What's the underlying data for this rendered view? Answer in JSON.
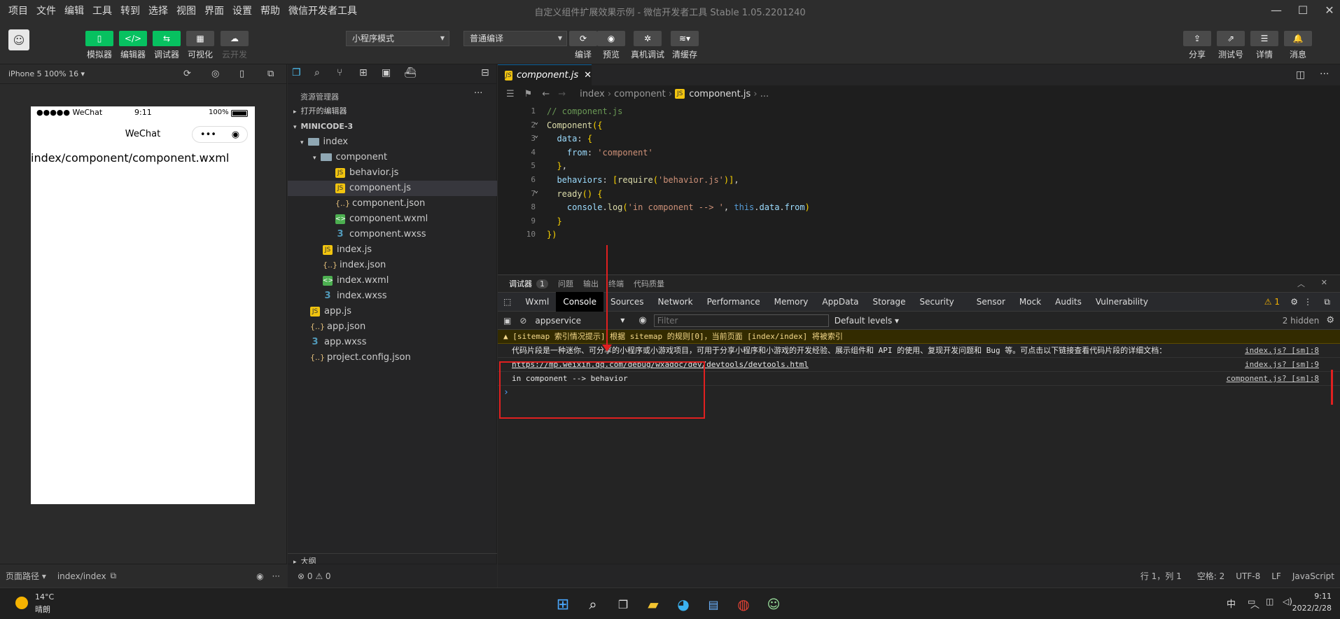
{
  "menu": [
    "项目",
    "文件",
    "编辑",
    "工具",
    "转到",
    "选择",
    "视图",
    "界面",
    "设置",
    "帮助",
    "微信开发者工具"
  ],
  "window_title": "自定义组件扩展效果示例 - 微信开发者工具 Stable 1.05.2201240",
  "toolbar": {
    "left": [
      {
        "label": "模拟器",
        "glyph": "▯",
        "style": "green"
      },
      {
        "label": "编辑器",
        "glyph": "</>",
        "style": "green"
      },
      {
        "label": "调试器",
        "glyph": "⇆",
        "style": "green"
      },
      {
        "label": "可视化",
        "glyph": "▦",
        "style": "gray"
      },
      {
        "label": "云开发",
        "glyph": "☁",
        "style": "gray"
      }
    ],
    "mode_select": "小程序模式",
    "compile_select": "普通编译",
    "mid": [
      {
        "label": "编译",
        "glyph": "⟳"
      },
      {
        "label": "预览",
        "glyph": "◉"
      },
      {
        "label": "真机调试",
        "glyph": "✲"
      },
      {
        "label": "清缓存",
        "glyph": "≋▾"
      }
    ],
    "right": [
      {
        "label": "分享",
        "glyph": "⇪"
      },
      {
        "label": "测试号",
        "glyph": "⇗"
      },
      {
        "label": "详情",
        "glyph": "☰"
      },
      {
        "label": "消息",
        "glyph": "🔔"
      }
    ]
  },
  "simulator": {
    "device": "iPhone 5 100% 16 ▾",
    "status_left": "●●●●● WeChat",
    "time": "9:11",
    "battery": "100%",
    "nav_title": "WeChat",
    "content": "index/component/component.wxml",
    "path_label": "页面路径 ▾",
    "path_value": "index/index"
  },
  "explorer": {
    "title": "资源管理器",
    "open_editors": "打开的编辑器",
    "project": "MINICODE-3",
    "outline": "大纲",
    "tree": [
      {
        "name": "index",
        "type": "folder",
        "depth": 1,
        "arrow": "▾"
      },
      {
        "name": "component",
        "type": "folder",
        "depth": 2,
        "arrow": "▾"
      },
      {
        "name": "behavior.js",
        "type": "js",
        "depth": 3
      },
      {
        "name": "component.js",
        "type": "js",
        "depth": 3,
        "active": true
      },
      {
        "name": "component.json",
        "type": "json",
        "depth": 3
      },
      {
        "name": "component.wxml",
        "type": "wxml",
        "depth": 3
      },
      {
        "name": "component.wxss",
        "type": "wxss",
        "depth": 3
      },
      {
        "name": "index.js",
        "type": "js",
        "depth": 2
      },
      {
        "name": "index.json",
        "type": "json",
        "depth": 2
      },
      {
        "name": "index.wxml",
        "type": "wxml",
        "depth": 2
      },
      {
        "name": "index.wxss",
        "type": "wxss",
        "depth": 2
      },
      {
        "name": "app.js",
        "type": "js",
        "depth": 1
      },
      {
        "name": "app.json",
        "type": "json",
        "depth": 1
      },
      {
        "name": "app.wxss",
        "type": "wxss",
        "depth": 1
      },
      {
        "name": "project.config.json",
        "type": "json",
        "depth": 1
      }
    ],
    "errors": "⊗ 0 ⚠ 0"
  },
  "editor": {
    "tab": "component.js",
    "breadcrumb": [
      "index",
      "component",
      "component.js",
      "..."
    ],
    "lines": [
      "// component.js",
      "Component({",
      "  data: {",
      "    from: 'component'",
      "  },",
      "  behaviors: [require('behavior.js')],",
      "  ready() {",
      "    console.log('in component --> ', this.data.from)",
      "  }",
      "})"
    ]
  },
  "console": {
    "panel_tabs": [
      "调试器",
      "问题",
      "输出",
      "终端",
      "代码质量"
    ],
    "badge": "1",
    "devtools_tabs": [
      "Wxml",
      "Console",
      "Sources",
      "Network",
      "Performance",
      "Memory",
      "AppData",
      "Storage",
      "Security",
      "Sensor",
      "Mock",
      "Audits",
      "Vulnerability"
    ],
    "active_tab": "Console",
    "warn_count": "⚠ 1",
    "context": "appservice",
    "filter_placeholder": "Filter",
    "levels": "Default levels ▾",
    "hidden": "2 hidden",
    "messages": [
      {
        "text": "▲ [sitemap 索引情况提示] 根据 sitemap 的规则[0]，当前页面 [index/index] 将被索引",
        "source": "",
        "warn": true
      },
      {
        "text": "代码片段是一种迷你、可分享的小程序或小游戏项目，可用于分享小程序和小游戏的开发经验、展示组件和 API 的使用、复现开发问题和 Bug 等。可点击以下链接查看代码片段的详细文档：",
        "source": "index.js? [sm]:8",
        "warn": false
      },
      {
        "text": "https://mp.weixin.qq.com/debug/wxadoc/dev/devtools/devtools.html",
        "source": "index.js? [sm]:9",
        "warn": false,
        "link": true
      },
      {
        "text": "in component -->  behavior",
        "source": "component.js? [sm]:8",
        "warn": false
      }
    ],
    "prompt": "›"
  },
  "statusbar": {
    "position": "行 1，列 1",
    "spaces": "空格: 2",
    "encoding": "UTF-8",
    "eol": "LF",
    "language": "JavaScript"
  },
  "taskbar": {
    "weather_temp": "14°C",
    "weather_desc": "晴朗",
    "ime": "中",
    "time": "9:11",
    "date": "2022/2/28"
  },
  "colors": {
    "accent_green": "#07c160",
    "annotation_red": "#e02020"
  }
}
